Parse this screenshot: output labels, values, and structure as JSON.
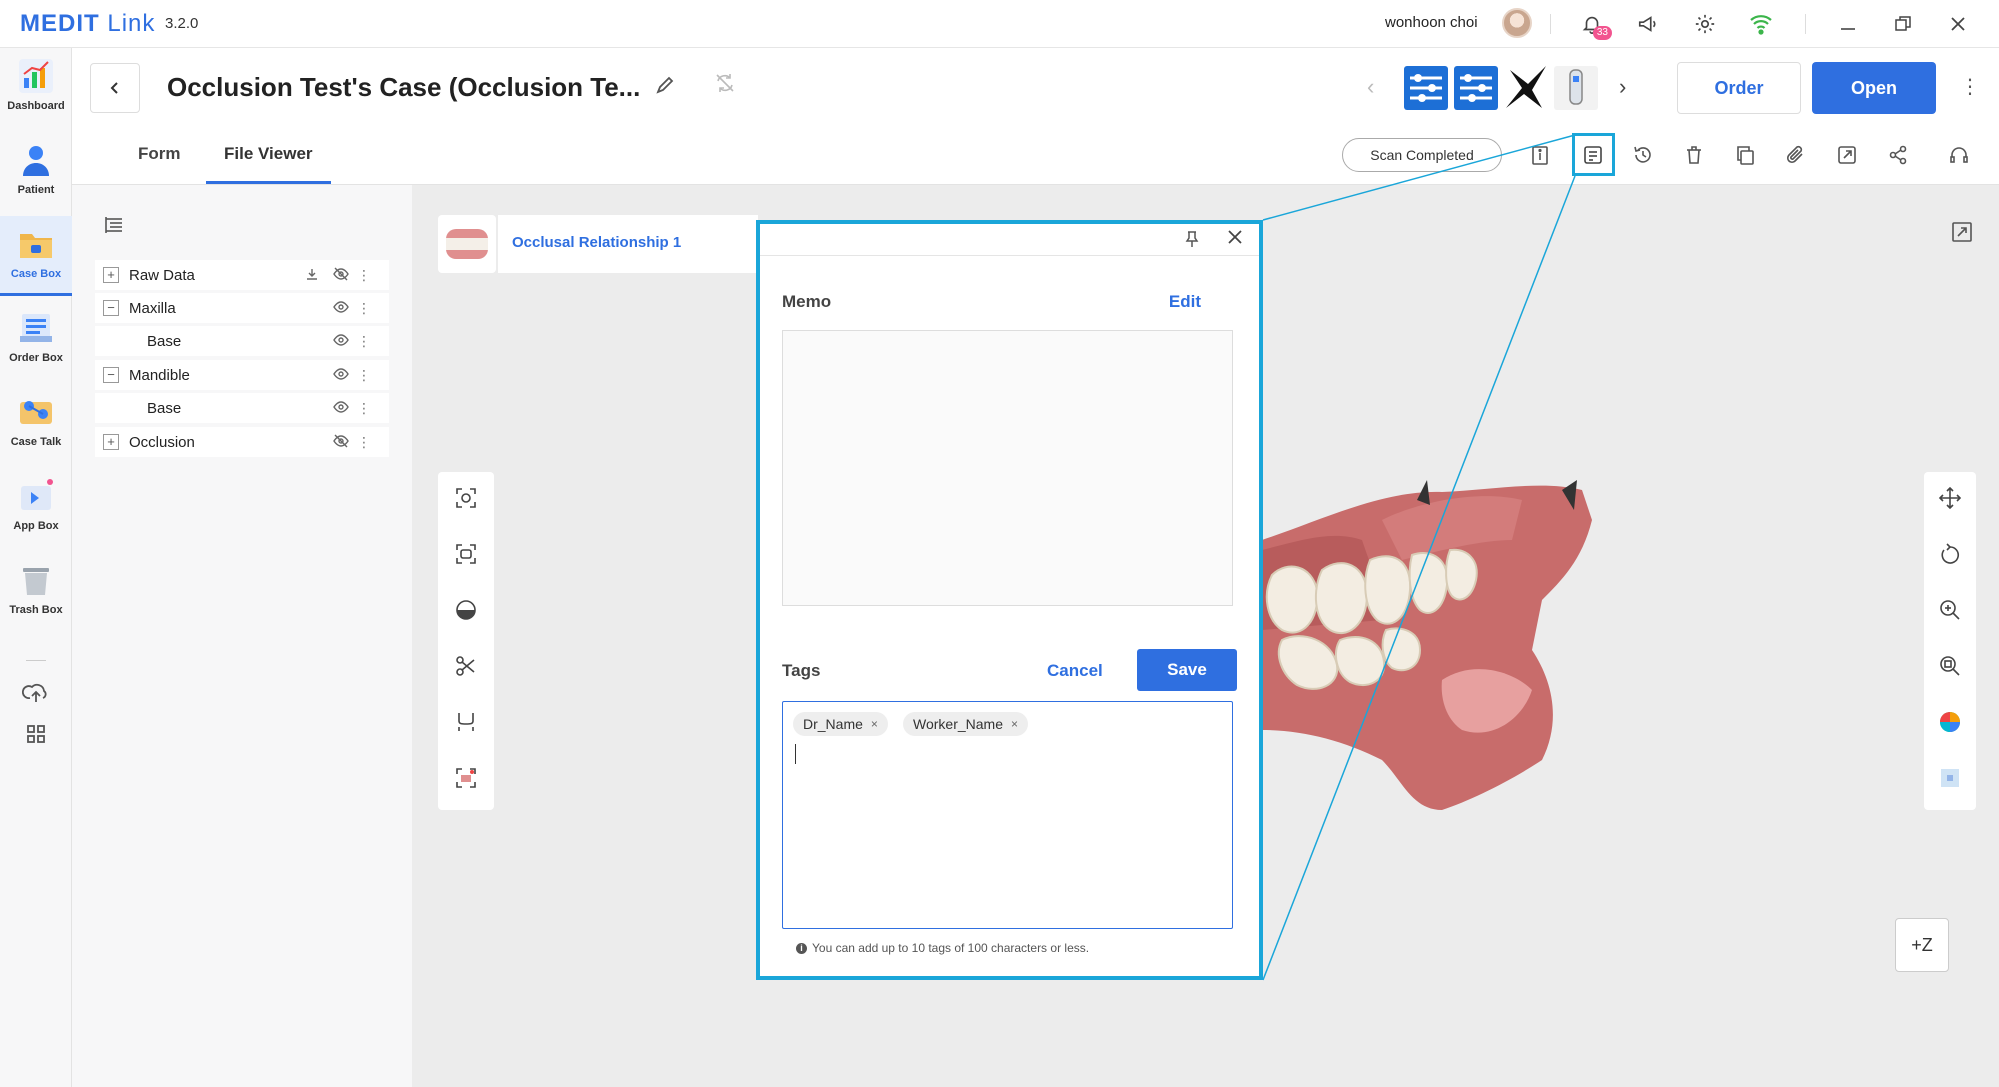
{
  "app": {
    "logo_main": "MEDIT",
    "logo_sub": "Link",
    "version": "3.2.0"
  },
  "user": {
    "name": "wonhoon choi",
    "notification_count": "33"
  },
  "sidebar": {
    "items": [
      {
        "label": "Dashboard"
      },
      {
        "label": "Patient"
      },
      {
        "label": "Case Box"
      },
      {
        "label": "Order Box"
      },
      {
        "label": "Case Talk"
      },
      {
        "label": "App Box"
      },
      {
        "label": "Trash Box"
      }
    ]
  },
  "header": {
    "title": "Occlusion Test's Case (Occlusion Te...",
    "order_label": "Order",
    "open_label": "Open"
  },
  "tabs": [
    {
      "label": "Form"
    },
    {
      "label": "File Viewer"
    }
  ],
  "status": {
    "scan_label": "Scan Completed"
  },
  "tree": {
    "rows": [
      {
        "label": "Raw Data",
        "toggle": "+"
      },
      {
        "label": "Maxilla",
        "toggle": "−"
      },
      {
        "label": "Base"
      },
      {
        "label": "Mandible",
        "toggle": "−"
      },
      {
        "label": "Base"
      },
      {
        "label": "Occlusion",
        "toggle": "+"
      }
    ]
  },
  "viewer": {
    "occlusion_label": "Occlusal Relationship 1",
    "axis_label": "+Z"
  },
  "memo_popup": {
    "memo_label": "Memo",
    "edit_label": "Edit",
    "tags_label": "Tags",
    "cancel_label": "Cancel",
    "save_label": "Save",
    "tags": [
      "Dr_Name",
      "Worker_Name"
    ],
    "tag_remove": "×",
    "hint": "You can add up to 10 tags of 100 characters or less."
  },
  "colors": {
    "accent": "#2f6fe0",
    "highlight": "#1aa6d9"
  }
}
